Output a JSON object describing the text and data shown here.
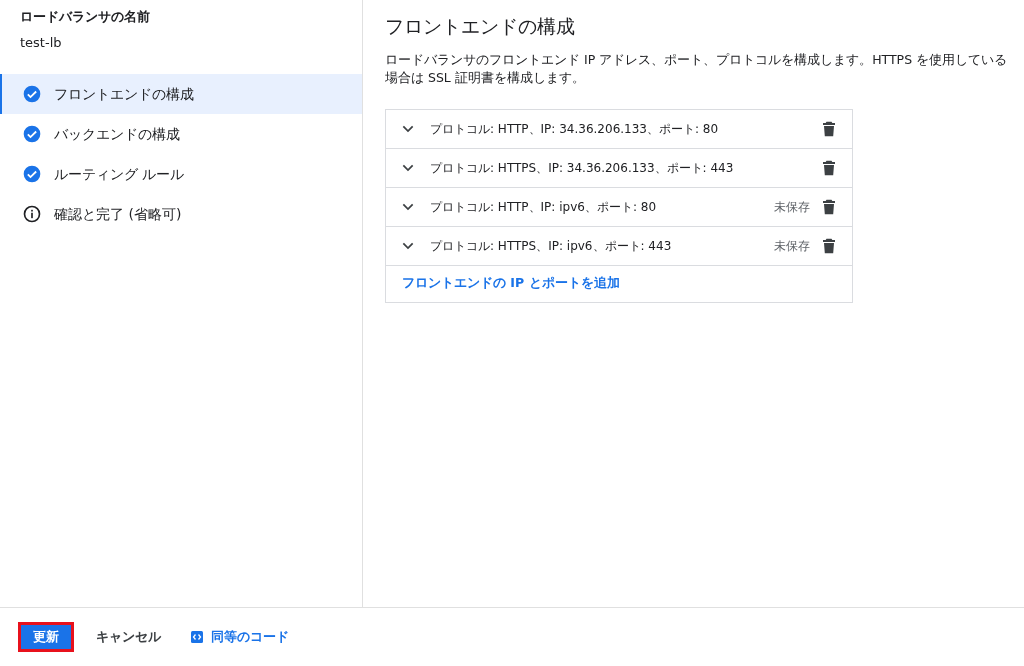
{
  "sidebar": {
    "name_label": "ロードバランサの名前",
    "name_value": "test-lb",
    "steps": [
      {
        "label": "フロントエンドの構成",
        "kind": "done",
        "selected": true
      },
      {
        "label": "バックエンドの構成",
        "kind": "done",
        "selected": false
      },
      {
        "label": "ルーティング ルール",
        "kind": "done",
        "selected": false
      },
      {
        "label": "確認と完了 (省略可)",
        "kind": "info",
        "selected": false
      }
    ]
  },
  "main": {
    "title": "フロントエンドの構成",
    "description": "ロードバランサのフロントエンド IP アドレス、ポート、プロトコルを構成します。HTTPS を使用している場合は SSL 証明書を構成します。",
    "frontends": [
      {
        "text": "プロトコル: HTTP、IP: 34.36.206.133、ポート: 80"
      },
      {
        "text": "プロトコル: HTTPS、IP: 34.36.206.133、ポート: 443"
      },
      {
        "text": "プロトコル: HTTP、IP: ipv6、ポート: 80",
        "status": "未保存"
      },
      {
        "text": "プロトコル: HTTPS、IP: ipv6、ポート: 443",
        "status": "未保存"
      }
    ],
    "add_link": "フロントエンドの IP とポートを追加"
  },
  "footer": {
    "update_button": {
      "label": "更新",
      "highlighted": true
    },
    "cancel_button": "キャンセル",
    "code_link": "同等のコード"
  }
}
